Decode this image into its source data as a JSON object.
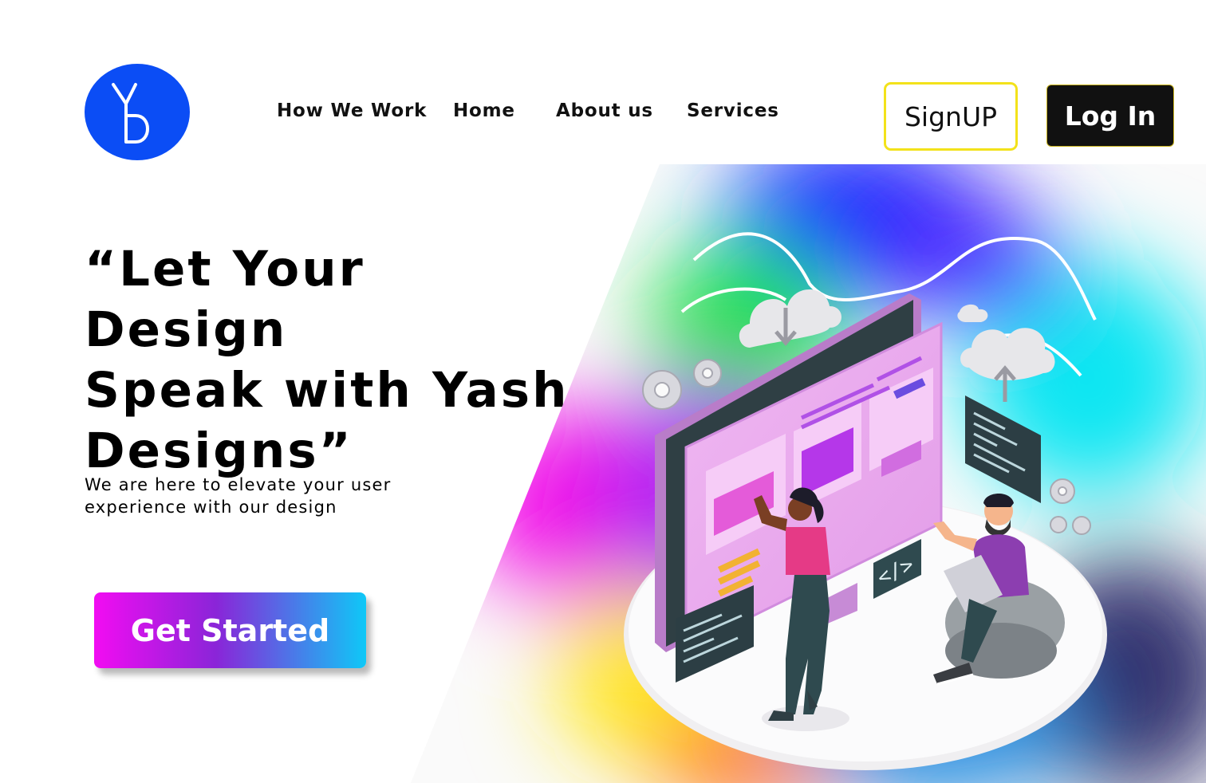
{
  "logo": {
    "initials": "YD",
    "color": "#0b4df5"
  },
  "nav": {
    "items": [
      {
        "label": "How We Work"
      },
      {
        "label": "Home"
      },
      {
        "label": "About us"
      },
      {
        "label": "Services"
      }
    ]
  },
  "auth": {
    "signup_label": "SignUP",
    "login_label": "Log In",
    "signup_border_color": "#f3e21a",
    "login_background": "#111111"
  },
  "hero": {
    "title": "“Let Your Design\nSpeak  with Yash\nDesigns”",
    "subtitle": "We are here to elevate your user experience with our design",
    "cta_label": "Get Started",
    "cta_gradient": [
      "#f20cf2",
      "#8a25d8",
      "#0fc8f7"
    ]
  },
  "illustration": {
    "code_tag": "</>",
    "icons": [
      "cloud-download-icon",
      "cloud-upload-icon",
      "gear-icon",
      "code-icon",
      "laptop-icon"
    ]
  }
}
